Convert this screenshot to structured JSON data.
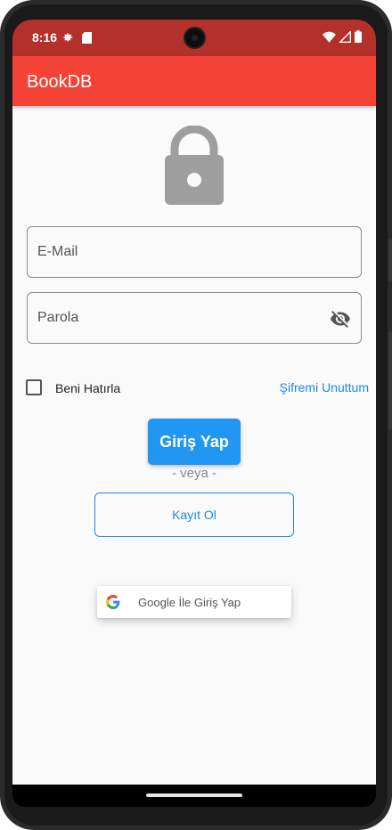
{
  "status_bar": {
    "time": "8:16",
    "icons": [
      "gear-icon",
      "sd-card-icon",
      "wifi-icon",
      "signal-icon",
      "battery-icon"
    ],
    "background": "#b3312a"
  },
  "app_bar": {
    "title": "BookDB",
    "background": "#f44336"
  },
  "login_form": {
    "email_label": "E-Mail",
    "password_label": "Parola",
    "remember_me_label": "Beni Hatırla",
    "remember_me_checked": false,
    "forgot_password_label": "Şifremi Unuttum",
    "login_button_label": "Giriş Yap",
    "or_divider": "- veya -",
    "register_button_label": "Kayıt Ol",
    "google_button_label": "Google İle Giriş Yap"
  },
  "colors": {
    "accent_blue": "#2196f3",
    "link_blue": "#1e88e5",
    "lock_gray": "#9e9e9e"
  }
}
